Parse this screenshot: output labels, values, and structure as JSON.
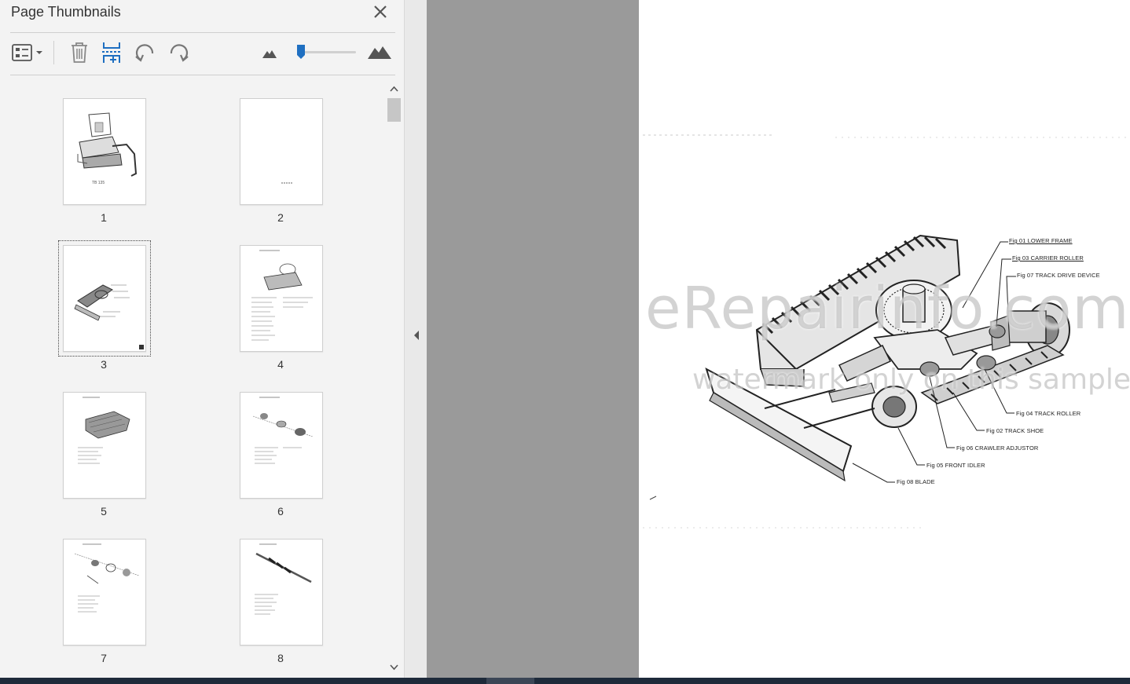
{
  "panel": {
    "title": "Page Thumbnails",
    "close_icon": "close-icon",
    "toolbar": {
      "options_icon": "thumbnail-options-icon",
      "delete_icon": "trash-icon",
      "insert_icon": "insert-pages-icon",
      "rotate_ccw_icon": "rotate-counterclockwise-icon",
      "rotate_cw_icon": "rotate-clockwise-icon",
      "zoom_out_icon": "zoom-out-mountain-icon",
      "zoom_in_icon": "zoom-in-mountain-icon",
      "zoom_level": 0.05
    },
    "thumbnails": [
      {
        "page": "1",
        "caption": "TB 135"
      },
      {
        "page": "2",
        "caption": ""
      },
      {
        "page": "3",
        "caption": "",
        "selected": true
      },
      {
        "page": "4",
        "caption": ""
      },
      {
        "page": "5",
        "caption": ""
      },
      {
        "page": "6",
        "caption": ""
      },
      {
        "page": "7",
        "caption": ""
      },
      {
        "page": "8",
        "caption": ""
      }
    ]
  },
  "document": {
    "labels": {
      "fig01": "Fig 01   LOWER  FRAME",
      "fig03": "Fig 03   CARRIER  ROLLER",
      "fig07": "Fig 07   TRACK  DRIVE  DEVICE",
      "fig04": "Fig 04   TRACK   ROLLER",
      "fig02": "Fig 02   TRACK   SHOE",
      "fig06": "Fig 06   CRAWLER   ADJUSTOR",
      "fig05": "Fig 05   FRONT   IDLER",
      "fig08": "Fig 08   BLADE"
    },
    "watermark_main": "eRepairinfo.com",
    "watermark_sub": "watermark only on this sample"
  },
  "colors": {
    "panel_bg": "#f3f3f3",
    "gutter": "#9a9a9a",
    "accent_blue": "#1f6fc1",
    "bottom_bar": "#1e2a3a"
  }
}
